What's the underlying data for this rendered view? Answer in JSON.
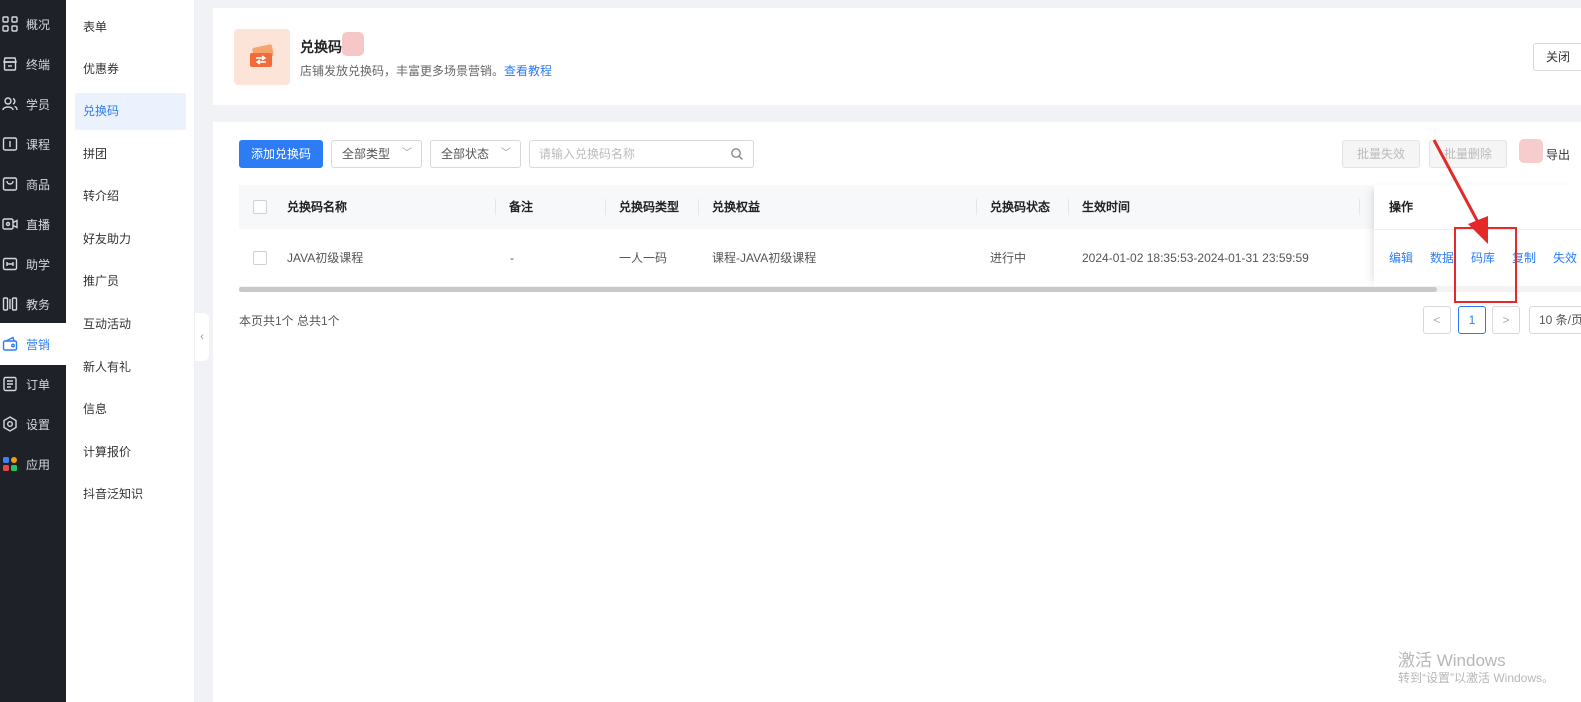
{
  "nav": {
    "items": [
      {
        "label": "概况",
        "icon": "grid-icon"
      },
      {
        "label": "终端",
        "icon": "store-icon"
      },
      {
        "label": "学员",
        "icon": "users-icon"
      },
      {
        "label": "课程",
        "icon": "course-icon"
      },
      {
        "label": "商品",
        "icon": "bag-icon"
      },
      {
        "label": "直播",
        "icon": "live-icon"
      },
      {
        "label": "助学",
        "icon": "assist-icon"
      },
      {
        "label": "教务",
        "icon": "columns-icon"
      },
      {
        "label": "营销",
        "icon": "marketing-icon"
      },
      {
        "label": "订单",
        "icon": "order-icon"
      },
      {
        "label": "设置",
        "icon": "gear-icon"
      },
      {
        "label": "应用",
        "icon": "apps-icon"
      }
    ],
    "active_index": 8
  },
  "submenu": {
    "items": [
      "表单",
      "优惠券",
      "兑换码",
      "拼团",
      "转介绍",
      "好友助力",
      "推广员",
      "互动活动",
      "新人有礼",
      "信息",
      "计算报价",
      "抖音泛知识"
    ],
    "active_index": 2
  },
  "header": {
    "title": "兑换码",
    "description": "店铺发放兑换码，丰富更多场景营销。",
    "link": "查看教程",
    "close_label": "关闭"
  },
  "toolbar": {
    "add_label": "添加兑换码",
    "type_select": "全部类型",
    "status_select": "全部状态",
    "search_placeholder": "请输入兑换码名称",
    "batch_invalidate": "批量失效",
    "batch_delete": "批量删除",
    "export_label": "导出"
  },
  "table": {
    "columns": [
      "兑换码名称",
      "备注",
      "兑换码类型",
      "兑换权益",
      "兑换码状态",
      "生效时间",
      "操作"
    ],
    "rows": [
      {
        "name": "JAVA初级课程",
        "remark": "-",
        "type": "一人一码",
        "benefit": "课程-JAVA初级课程",
        "status": "进行中",
        "time": "2024-01-02 18:35:53-2024-01-31 23:59:59",
        "actions": [
          "编辑",
          "数据",
          "码库",
          "复制",
          "失效"
        ]
      }
    ]
  },
  "pagination": {
    "summary": "本页共1个 总共1个",
    "prev": "<",
    "current": "1",
    "next": ">",
    "page_size": "10 条/页"
  },
  "watermark": {
    "line1": "激活 Windows",
    "line2": "转到“设置”以激活 Windows。"
  },
  "colors": {
    "primary": "#2d7cf6",
    "nav_bg": "#1f2129",
    "annotation": "#e52929"
  }
}
